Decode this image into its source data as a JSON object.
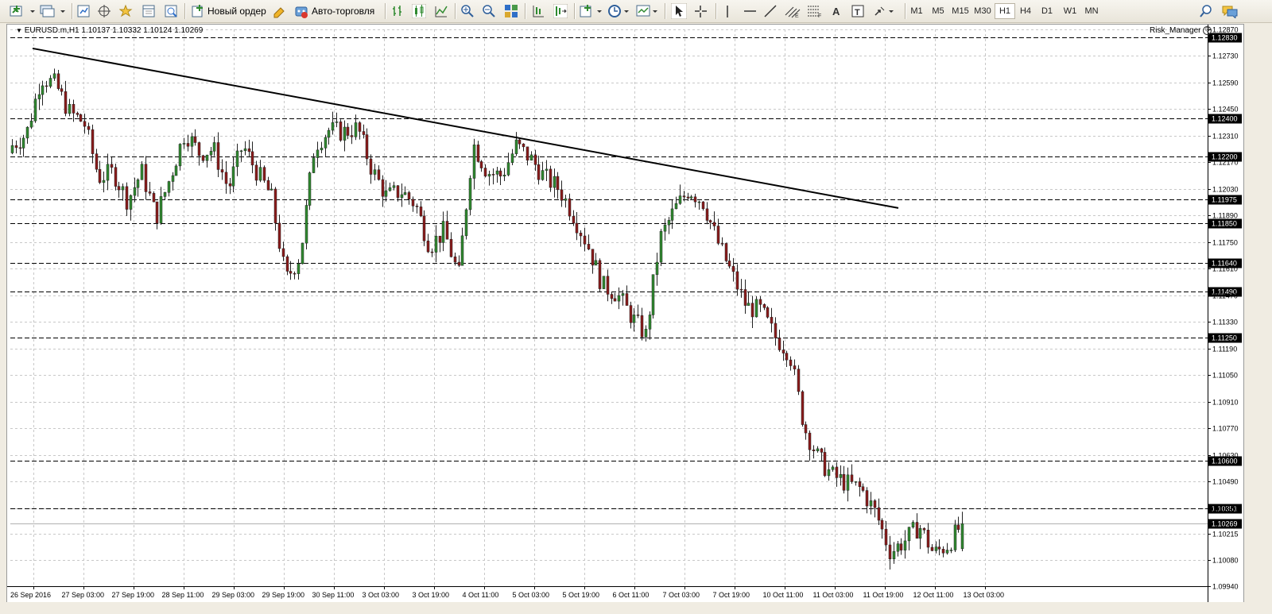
{
  "toolbar": {
    "new_order_label": "Новый ордер",
    "autotrading_label": "Авто-торговля",
    "timeframes": [
      "M1",
      "M5",
      "M15",
      "M30",
      "H1",
      "H4",
      "D1",
      "W1",
      "MN"
    ],
    "active_timeframe": "H1"
  },
  "chart": {
    "symbol_info": "EURUSD.m,H1  1.10137 1.10332 1.10124 1.10269",
    "indicator_label": "Risk_Manager",
    "price_ticks": [
      "1.12870",
      "1.12730",
      "1.12590",
      "1.12450",
      "1.12310",
      "1.12170",
      "1.12030",
      "1.11890",
      "1.11750",
      "1.11610",
      "1.11470",
      "1.11330",
      "1.11190",
      "1.11050",
      "1.10910",
      "1.10770",
      "1.10630",
      "1.10490",
      "1.10350",
      "1.10215",
      "1.10080",
      "1.09940"
    ],
    "time_ticks": [
      "26 Sep 2016",
      "27 Sep 03:00",
      "27 Sep 19:00",
      "28 Sep 11:00",
      "29 Sep 03:00",
      "29 Sep 19:00",
      "30 Sep 11:00",
      "3 Oct 03:00",
      "3 Oct 19:00",
      "4 Oct 11:00",
      "5 Oct 03:00",
      "5 Oct 19:00",
      "6 Oct 11:00",
      "7 Oct 03:00",
      "7 Oct 19:00",
      "10 Oct 11:00",
      "11 Oct 03:00",
      "11 Oct 19:00",
      "12 Oct 11:00",
      "13 Oct 03:00"
    ],
    "level_labels": [
      "1.12830",
      "1.12400",
      "1.12200",
      "1.11975",
      "1.11850",
      "1.11640",
      "1.11490",
      "1.11250",
      "1.10600",
      "1.10351"
    ],
    "current_price": "1.10269",
    "colors": {
      "bull": "#2f8a2f",
      "bear": "#8b1a1a",
      "grid": "#c8c8c8",
      "level": "#000000"
    }
  },
  "chart_data": {
    "type": "candlestick",
    "symbol": "EURUSD.m",
    "timeframe": "H1",
    "last_bar": {
      "open": 1.10137,
      "high": 1.10332,
      "low": 1.10124,
      "close": 1.10269
    },
    "y_range": [
      1.0994,
      1.1287
    ],
    "horizontal_levels": [
      1.1283,
      1.124,
      1.122,
      1.11975,
      1.1185,
      1.1164,
      1.1149,
      1.1125,
      1.106,
      1.10351
    ],
    "trendline": {
      "from": {
        "time": "26 Sep 2016",
        "price": 1.1277
      },
      "to": {
        "time": "12 Oct 19:00",
        "price": 1.1193
      }
    },
    "close_path": [
      1.1226,
      1.1232,
      1.1262,
      1.1258,
      1.1243,
      1.1238,
      1.1209,
      1.1212,
      1.1197,
      1.1212,
      1.1188,
      1.121,
      1.1233,
      1.1222,
      1.1224,
      1.1203,
      1.1226,
      1.1212,
      1.1199,
      1.1155,
      1.1168,
      1.1226,
      1.1234,
      1.1233,
      1.1235,
      1.1213,
      1.1199,
      1.1202,
      1.1195,
      1.1173,
      1.1181,
      1.1157,
      1.1227,
      1.1212,
      1.121,
      1.1226,
      1.1219,
      1.1209,
      1.1203,
      1.1189,
      1.1173,
      1.1152,
      1.1148,
      1.1136,
      1.1126,
      1.1177,
      1.1192,
      1.1203,
      1.1196,
      1.1175,
      1.1158,
      1.1141,
      1.1139,
      1.1125,
      1.1117,
      1.1078,
      1.1061,
      1.1052,
      1.1048,
      1.1045,
      1.1032,
      1.1012,
      1.1018,
      1.1026,
      1.1011,
      1.1016,
      1.1027
    ]
  }
}
